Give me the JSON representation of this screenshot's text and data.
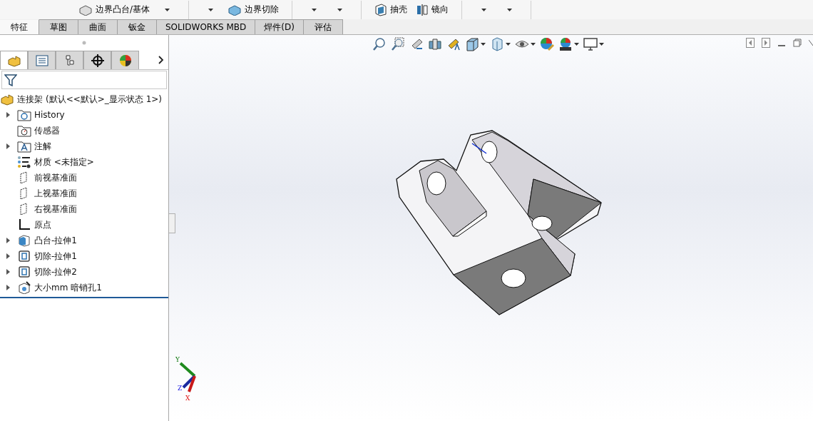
{
  "ribbon": {
    "items": [
      {
        "kind": "command",
        "label": "边界凸台/基体"
      },
      {
        "kind": "caret"
      },
      {
        "kind": "separator"
      },
      {
        "kind": "caret"
      },
      {
        "kind": "command",
        "label": "边界切除"
      },
      {
        "kind": "separator"
      },
      {
        "kind": "caret"
      },
      {
        "kind": "caret"
      },
      {
        "kind": "separator"
      },
      {
        "kind": "command",
        "label": "抽壳"
      },
      {
        "kind": "command",
        "label": "镜向"
      },
      {
        "kind": "separator"
      },
      {
        "kind": "caret"
      },
      {
        "kind": "caret"
      },
      {
        "kind": "separator"
      }
    ]
  },
  "tabs": [
    {
      "label": "特征",
      "selected": true
    },
    {
      "label": "草图",
      "selected": false
    },
    {
      "label": "曲面",
      "selected": false
    },
    {
      "label": "钣金",
      "selected": false
    },
    {
      "label": "SOLIDWORKS MBD",
      "selected": false
    },
    {
      "label": "焊件(D)",
      "selected": false
    },
    {
      "label": "评估",
      "selected": false
    }
  ],
  "panel_tabs": [
    {
      "selected": true
    },
    {
      "selected": false
    },
    {
      "selected": false
    },
    {
      "selected": false
    },
    {
      "selected": false
    }
  ],
  "tree": {
    "root": {
      "name": "连接架",
      "config": "(默认<<默认>_显示状态 1>)"
    },
    "items": [
      {
        "kind": "history",
        "label": "History",
        "expandable": true
      },
      {
        "kind": "sensor",
        "label": "传感器",
        "expandable": false
      },
      {
        "kind": "annotation",
        "label": "注解",
        "expandable": true
      },
      {
        "kind": "material",
        "label": "材质 <未指定>",
        "expandable": false
      },
      {
        "kind": "plane",
        "label": "前视基准面",
        "expandable": false
      },
      {
        "kind": "plane",
        "label": "上视基准面",
        "expandable": false
      },
      {
        "kind": "plane",
        "label": "右视基准面",
        "expandable": false
      },
      {
        "kind": "origin",
        "label": "原点",
        "expandable": false
      },
      {
        "kind": "boss",
        "label": "凸台-拉伸1",
        "expandable": true
      },
      {
        "kind": "cut",
        "label": "切除-拉伸1",
        "expandable": true
      },
      {
        "kind": "cut",
        "label": "切除-拉伸2",
        "expandable": true
      },
      {
        "kind": "hole",
        "label": "大小mm 暗销孔1",
        "expandable": true
      }
    ]
  },
  "view_toolbar": [
    {
      "caret": false
    },
    {
      "caret": false
    },
    {
      "caret": false
    },
    {
      "caret": false
    },
    {
      "caret": false
    },
    {
      "caret": true
    },
    {
      "caret": true
    },
    {
      "caret": true
    },
    {
      "caret": false
    },
    {
      "caret": true
    },
    {
      "caret": true
    }
  ],
  "triad": {
    "y": "Y",
    "z": "Z",
    "x": "X"
  }
}
